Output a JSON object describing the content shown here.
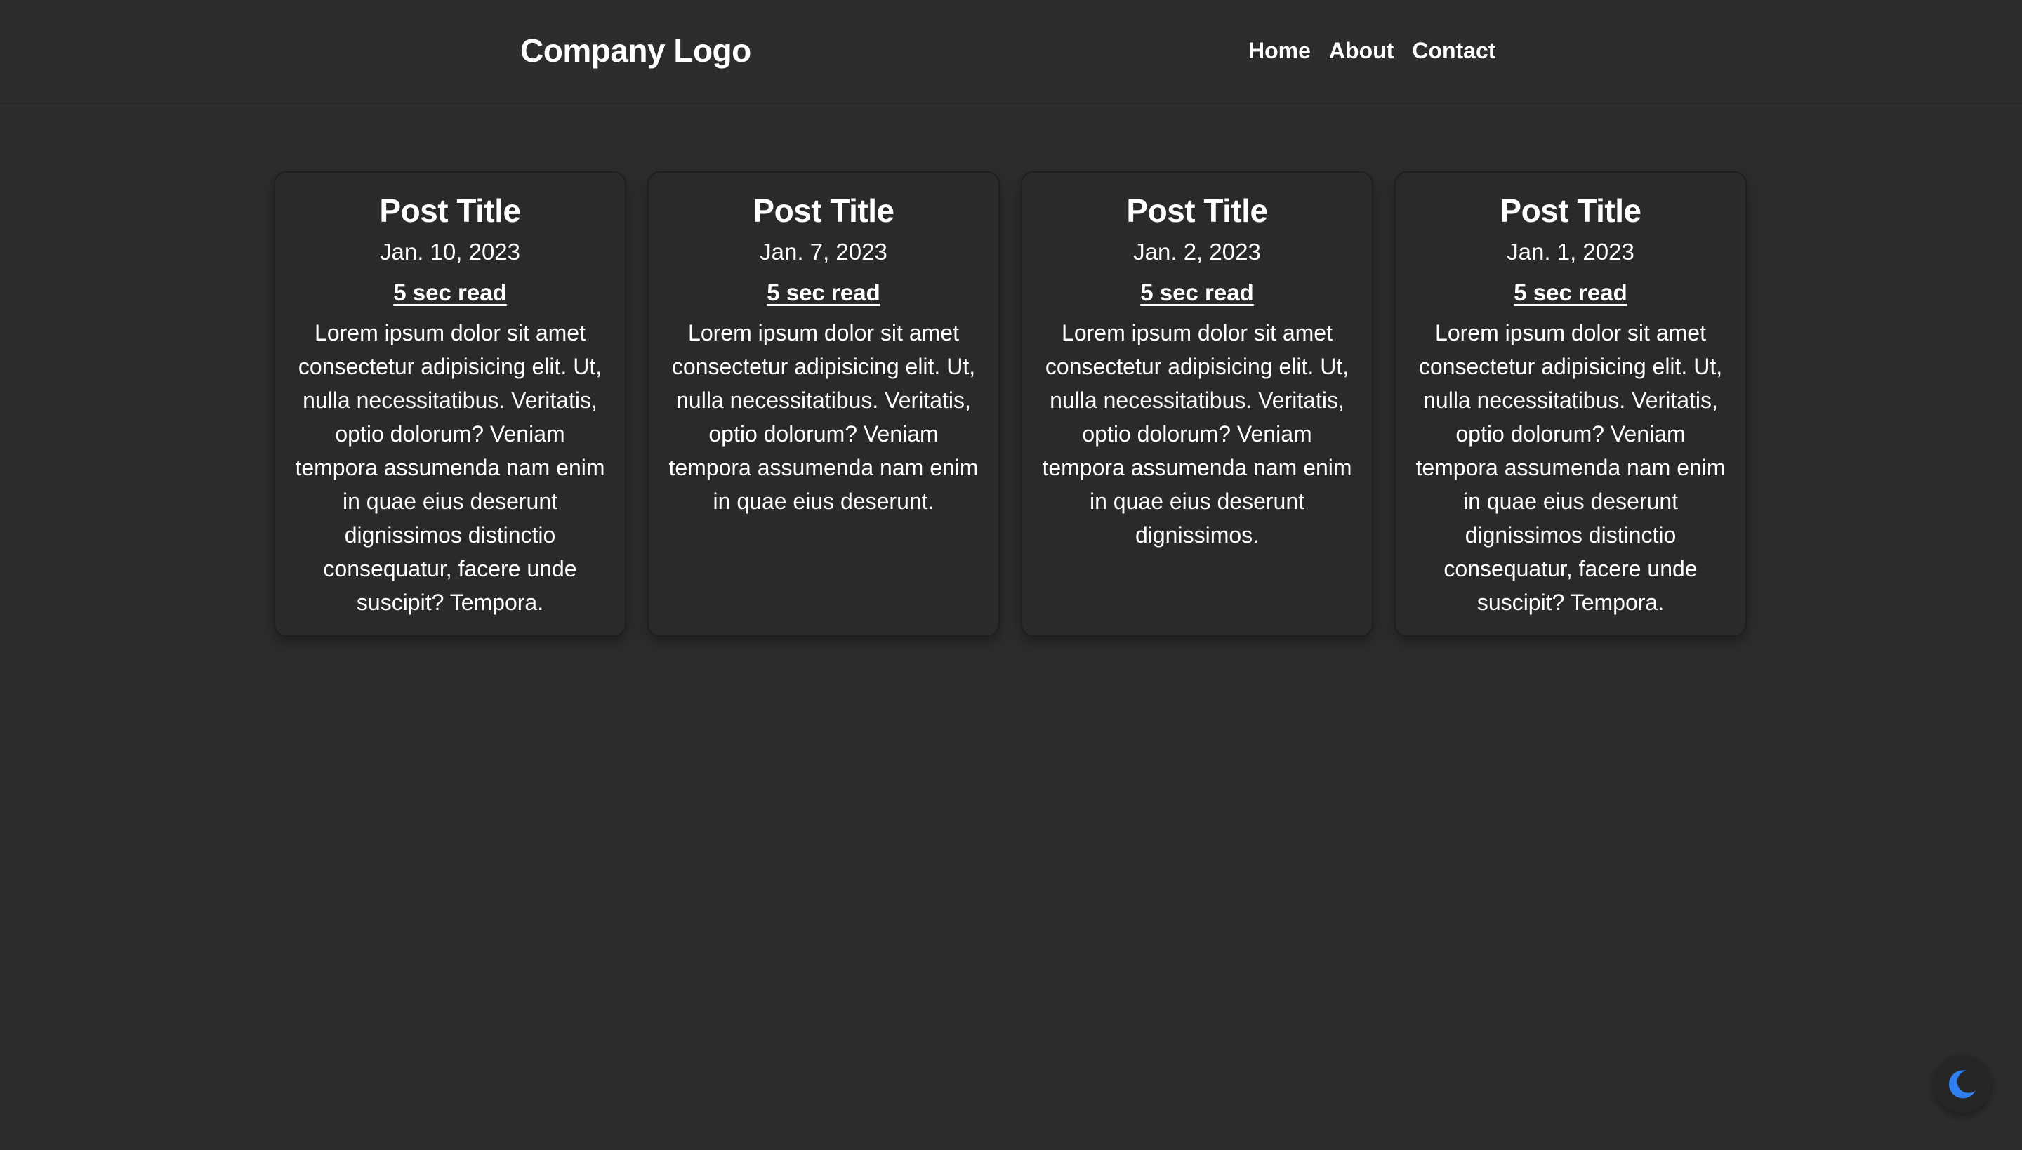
{
  "header": {
    "logo_text": "Company Logo",
    "nav": [
      {
        "label": "Home"
      },
      {
        "label": "About"
      },
      {
        "label": "Contact"
      }
    ]
  },
  "posts": [
    {
      "title": "Post Title",
      "date": "Jan. 10, 2023",
      "read_time": "5 sec read",
      "body": "Lorem ipsum dolor sit amet consectetur adipisicing elit. Ut, nulla necessitatibus. Veritatis, optio dolorum? Veniam tempora assumenda nam enim in quae eius deserunt dignissimos distinctio consequatur, facere unde suscipit? Tempora."
    },
    {
      "title": "Post Title",
      "date": "Jan. 7, 2023",
      "read_time": "5 sec read",
      "body": "Lorem ipsum dolor sit amet consectetur adipisicing elit. Ut, nulla necessitatibus. Veritatis, optio dolorum? Veniam tempora assumenda nam enim in quae eius deserunt."
    },
    {
      "title": "Post Title",
      "date": "Jan. 2, 2023",
      "read_time": "5 sec read",
      "body": "Lorem ipsum dolor sit amet consectetur adipisicing elit. Ut, nulla necessitatibus. Veritatis, optio dolorum? Veniam tempora assumenda nam enim in quae eius deserunt dignissimos."
    },
    {
      "title": "Post Title",
      "date": "Jan. 1, 2023",
      "read_time": "5 sec read",
      "body": "Lorem ipsum dolor sit amet consectetur adipisicing elit. Ut, nulla necessitatibus. Veritatis, optio dolorum? Veniam tempora assumenda nam enim in quae eius deserunt dignissimos distinctio consequatur, facere unde suscipit? Tempora."
    }
  ],
  "theme_toggle": {
    "icon": "moon-icon",
    "icon_color": "#2f7ff0"
  },
  "colors": {
    "background": "#2d2d2d",
    "card_background": "#2a2a2a",
    "text": "#ffffff"
  }
}
